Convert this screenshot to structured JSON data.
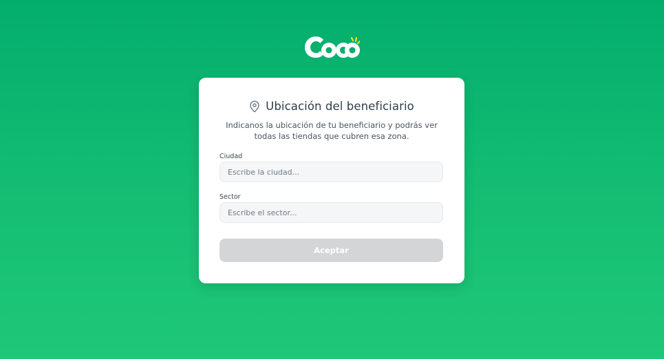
{
  "brand": {
    "logo_text": "coco",
    "colors": {
      "background_top": "#03ad6d",
      "background_bottom": "#1fc878",
      "logo_accent": "#e8e82a"
    }
  },
  "card": {
    "title": "Ubicación del beneficiario",
    "title_icon": "location-pin-icon",
    "subtitle": "Indicanos la ubicación de tu beneficiario y podrás ver todas las tiendas que cubren esa zona."
  },
  "form": {
    "city": {
      "label": "Ciudad",
      "placeholder": "Escribe la ciudad...",
      "value": ""
    },
    "sector": {
      "label": "Sector",
      "placeholder": "Escribe el sector...",
      "value": ""
    },
    "submit_label": "Aceptar",
    "submit_state": "disabled"
  }
}
